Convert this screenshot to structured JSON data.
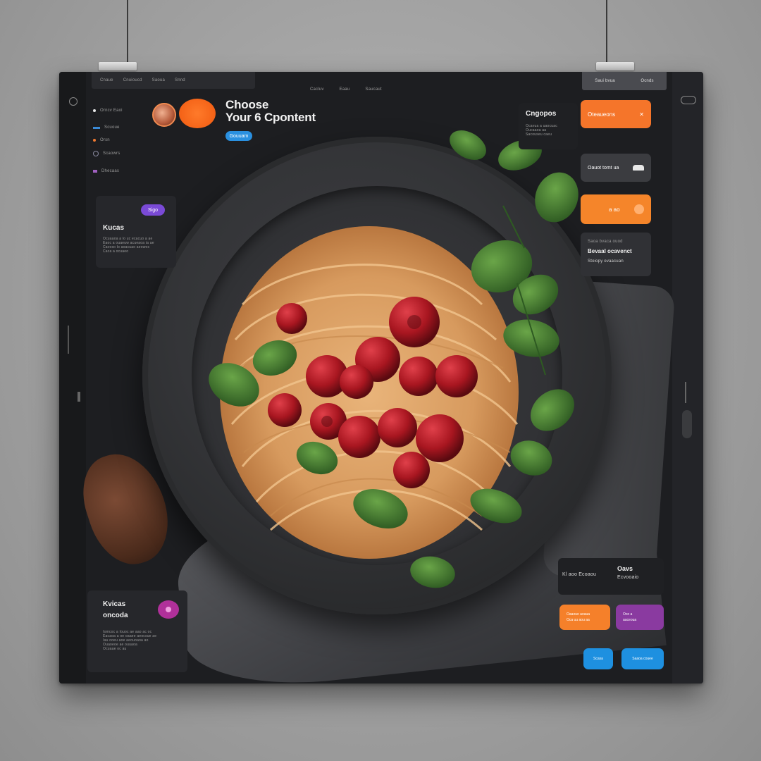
{
  "window": {
    "topbar_items": [
      "Cnaue",
      "Cnuioucd",
      "Saoua",
      "Snnd"
    ],
    "nav_items": [
      "Cacluv",
      "Eaau",
      "Saucaut"
    ],
    "top_right_tabs": [
      "Saui bvua",
      "Ocnds"
    ]
  },
  "sidebar": {
    "items": [
      {
        "label": "Orncv Eaoi",
        "color": "#e8e8e8"
      },
      {
        "label": "Scuoue",
        "color": "#3a8ad6"
      },
      {
        "label": "Orsn",
        "color": "#f07a30"
      },
      {
        "label": "Scaowrs",
        "color": "#8a8aa0"
      },
      {
        "label": "Dhecaas",
        "color": "#a060c0"
      }
    ]
  },
  "header": {
    "title_line1": "Choose",
    "title_line2": "Your 6 Cpontent",
    "cta_label": "Gouuam"
  },
  "card_left_top": {
    "badge": "Sigo",
    "title": "Kucas",
    "lines": [
      "Ocuaaoa a lo uc ecacuo a ae",
      "Eaoc a ouaeuw acueaoa ia ae",
      "Cavoso lo aoacuao aeowos",
      "Caca a ocuaeo"
    ]
  },
  "card_left_bottom": {
    "title_line1": "Kvicas",
    "title_line2": "oncoda",
    "lines": [
      "Iomcoc a Iouoc ae aao ac oc",
      "Eacaoa a oe oaaee aeocsue ae",
      "Iau ooeu aoe aeouoaoa ao",
      "Ouaoeoe ae ouuaoa",
      "Ocuaae oc au"
    ]
  },
  "card_right_top": {
    "title": "Cngopos",
    "lines": [
      "Ocavua a uaocuac",
      "Oucaaoa aa",
      "Sacouseu caeu"
    ]
  },
  "right_buttons": [
    {
      "label": "Oteaueons",
      "icon": "utensils-icon",
      "color": "#f5752a"
    },
    {
      "label": "Oauot tomt ua",
      "icon": "car-icon",
      "color": "#3b3c40"
    },
    {
      "label": "a ao",
      "icon": "coin-icon",
      "color": "#f5852a"
    }
  ],
  "card_right_mid": {
    "line1": "Saoa bvaca ouod",
    "line2": "Bevaal ocavenct",
    "line3": "Stoiopy ovaacuan"
  },
  "card_right_bottom": {
    "label": "Kl aoo Ecoaou",
    "title": "Oavs",
    "subtitle": "Ecvooaio"
  },
  "bottom_buttons": [
    {
      "label": "Oaaouo aoaua\nOca uu aou aa",
      "color": "#f5802a"
    },
    {
      "label": "Oco a\nauceoua",
      "color": "#8a3aa0"
    },
    {
      "label": "Scasa",
      "color": "#1e90e0"
    },
    {
      "label": "Saaoa couee",
      "color": "#1e90e0"
    }
  ],
  "colors": {
    "bg": "#1d1e21",
    "accent_orange": "#f5752a",
    "accent_blue": "#2a90e0",
    "accent_purple": "#8a3ab0"
  }
}
